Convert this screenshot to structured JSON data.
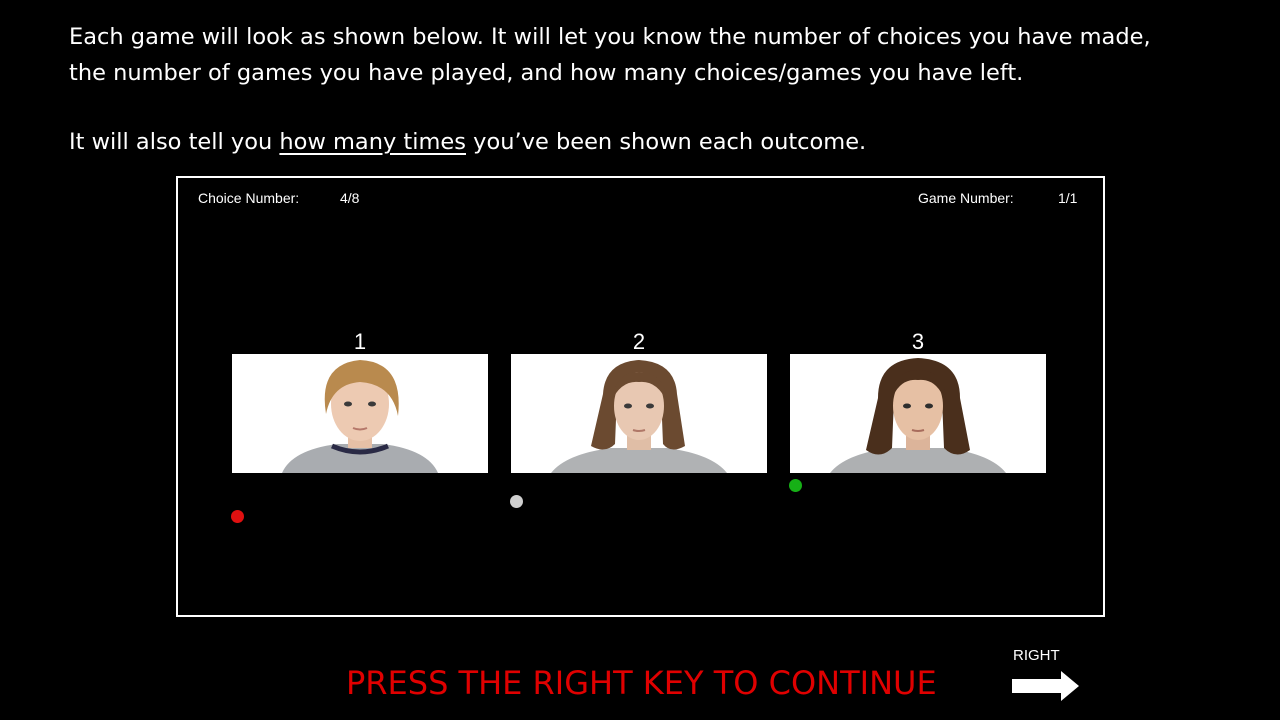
{
  "instructions": {
    "line1": "Each game will look as shown below. It will let you know the number of choices you have made,",
    "line2": "the number of games you have played, and how many choices/games you have left.",
    "line3_pre": "It will also tell you ",
    "line3_underlined": "how many times",
    "line3_post": " you’ve been shown each outcome."
  },
  "hud": {
    "choice_label": "Choice Number:",
    "choice_value": "4/8",
    "game_label": "Game Number:",
    "game_value": "1/1"
  },
  "options": [
    {
      "number": "1",
      "hair": "#b98a4e",
      "outcome": "negative",
      "outcome_color": "#e01010"
    },
    {
      "number": "2",
      "hair": "#6b4a30",
      "outcome": "neutral",
      "outcome_color": "#cfcfcf"
    },
    {
      "number": "3",
      "hair": "#4a2f1c",
      "outcome": "positive",
      "outcome_color": "#16b016"
    }
  ],
  "footer": {
    "prompt": "PRESS THE RIGHT KEY TO CONTINUE",
    "key_label": "RIGHT",
    "arrow_icon": "right-arrow-icon"
  }
}
